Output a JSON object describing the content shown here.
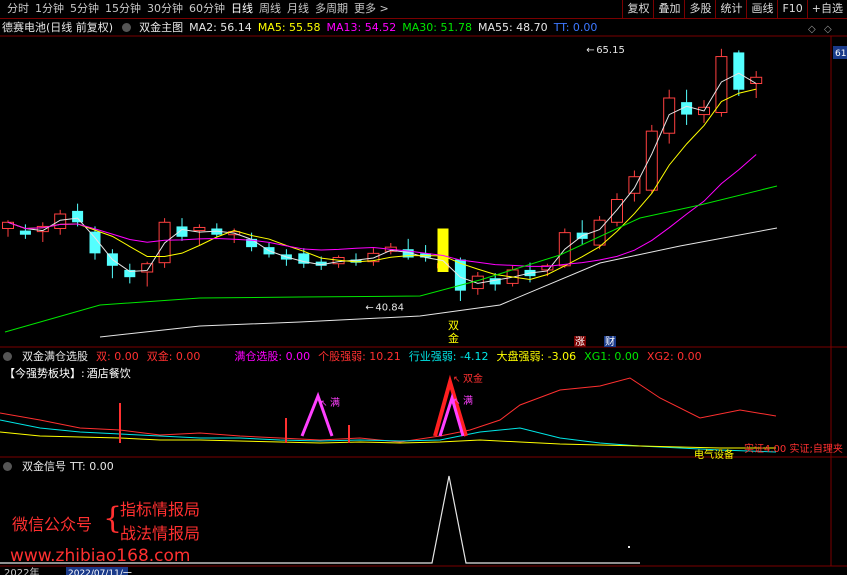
{
  "toolbar": {
    "periods": [
      {
        "label": "分时",
        "active": false
      },
      {
        "label": "1分钟",
        "active": false
      },
      {
        "label": "5分钟",
        "active": false
      },
      {
        "label": "15分钟",
        "active": false
      },
      {
        "label": "30分钟",
        "active": false
      },
      {
        "label": "60分钟",
        "active": false
      },
      {
        "label": "日线",
        "active": true
      },
      {
        "label": "周线",
        "active": false
      },
      {
        "label": "月线",
        "active": false
      },
      {
        "label": "多周期",
        "active": false
      },
      {
        "label": "更多 >",
        "active": false
      }
    ],
    "right_buttons": [
      "复权",
      "叠加",
      "多股",
      "统计",
      "画线",
      "F10",
      "+自选"
    ]
  },
  "main": {
    "stock_name": "德赛电池(日线 前复权)",
    "indicator_name": "双金主图",
    "ma": [
      {
        "label": "MA2: 56.14",
        "color": "#e6e6e6"
      },
      {
        "label": "MA5: 55.58",
        "color": "#ffff00"
      },
      {
        "label": "MA13: 54.52",
        "color": "#ff00ff"
      },
      {
        "label": "MA30: 51.78",
        "color": "#00e600"
      },
      {
        "label": "MA55: 48.70",
        "color": "#e6e6e6"
      },
      {
        "label": "TT: 0.00",
        "color": "#3c78ff"
      }
    ],
    "high_label": "65.15",
    "low_label": "40.84",
    "signal_label_1": "双",
    "signal_label_2": "金",
    "mark_zhang": "涨",
    "mark_cai": "财",
    "right_value": "61"
  },
  "sub1": {
    "title": "双金满仓选股",
    "values": [
      {
        "label": "双: 0.00",
        "color": "#ff3030"
      },
      {
        "label": "双金: 0.00",
        "color": "#ff3030"
      },
      {
        "label": "满仓选股: 0.00",
        "color": "#ff00ff"
      },
      {
        "label": "个股强弱: 10.21",
        "color": "#ff3030"
      },
      {
        "label": "行业强弱: -4.12",
        "color": "#00e6e6"
      },
      {
        "label": "大盘强弱: -3.06",
        "color": "#ffff00"
      },
      {
        "label": "XG1: 0.00",
        "color": "#00e600"
      },
      {
        "label": "XG2: 0.00",
        "color": "#ff3030"
      }
    ],
    "sector_prefix": "【今强势板块】:",
    "sector_name": "酒店餐饮",
    "label_man1": "满",
    "label_shuangjin": "双金",
    "label_man2": "满",
    "bottom_yellow": "电气设备",
    "bottom_red": "实证4.00 实证;自理夹"
  },
  "sub2": {
    "title": "双金信号",
    "value": "TT: 0.00"
  },
  "ad": {
    "line1": "微信公众号",
    "brace": "{",
    "line2": "指标情报局",
    "line3": "战法情报局",
    "site": "www.zhibiao168.com"
  },
  "date_axis": {
    "date1": "2022年",
    "date2": "2022/07/11/一"
  },
  "chart_data": {
    "type": "candlestick",
    "x_count": 44,
    "candles": [
      {
        "o": 47.8,
        "h": 48.6,
        "l": 47.0,
        "c": 48.4
      },
      {
        "o": 47.6,
        "h": 48.2,
        "l": 46.8,
        "c": 47.2
      },
      {
        "o": 47.5,
        "h": 48.4,
        "l": 46.5,
        "c": 48.0
      },
      {
        "o": 47.8,
        "h": 49.6,
        "l": 47.2,
        "c": 49.2
      },
      {
        "o": 49.5,
        "h": 50.2,
        "l": 48.0,
        "c": 48.4
      },
      {
        "o": 47.5,
        "h": 48.0,
        "l": 44.8,
        "c": 45.4
      },
      {
        "o": 45.4,
        "h": 45.8,
        "l": 43.0,
        "c": 44.2
      },
      {
        "o": 43.8,
        "h": 44.4,
        "l": 42.5,
        "c": 43.1
      },
      {
        "o": 43.6,
        "h": 44.6,
        "l": 42.2,
        "c": 44.4
      },
      {
        "o": 44.5,
        "h": 48.8,
        "l": 44.0,
        "c": 48.4
      },
      {
        "o": 48.0,
        "h": 48.8,
        "l": 46.6,
        "c": 47.0
      },
      {
        "o": 47.6,
        "h": 48.2,
        "l": 46.2,
        "c": 47.9
      },
      {
        "o": 47.8,
        "h": 48.3,
        "l": 47.0,
        "c": 47.2
      },
      {
        "o": 47.2,
        "h": 47.8,
        "l": 46.4,
        "c": 47.5
      },
      {
        "o": 46.8,
        "h": 47.4,
        "l": 45.6,
        "c": 46.0
      },
      {
        "o": 46.0,
        "h": 46.4,
        "l": 45.0,
        "c": 45.3
      },
      {
        "o": 45.3,
        "h": 45.8,
        "l": 44.2,
        "c": 44.8
      },
      {
        "o": 45.4,
        "h": 45.9,
        "l": 44.0,
        "c": 44.4
      },
      {
        "o": 44.6,
        "h": 45.1,
        "l": 43.8,
        "c": 44.2
      },
      {
        "o": 44.4,
        "h": 45.2,
        "l": 44.0,
        "c": 45.0
      },
      {
        "o": 44.8,
        "h": 45.4,
        "l": 44.2,
        "c": 44.5
      },
      {
        "o": 44.6,
        "h": 45.9,
        "l": 44.2,
        "c": 45.4
      },
      {
        "o": 45.6,
        "h": 46.4,
        "l": 45.3,
        "c": 46.0
      },
      {
        "o": 45.8,
        "h": 46.8,
        "l": 44.8,
        "c": 45.0
      },
      {
        "o": 45.4,
        "h": 46.2,
        "l": 44.6,
        "c": 45.0
      },
      {
        "o": 44.0,
        "h": 44.6,
        "l": 43.6,
        "c": 44.4
      },
      {
        "o": 44.8,
        "h": 45.0,
        "l": 40.8,
        "c": 41.8
      },
      {
        "o": 42.0,
        "h": 43.6,
        "l": 41.4,
        "c": 43.2
      },
      {
        "o": 43.0,
        "h": 43.5,
        "l": 41.8,
        "c": 42.4
      },
      {
        "o": 42.5,
        "h": 44.2,
        "l": 42.2,
        "c": 43.8
      },
      {
        "o": 43.8,
        "h": 44.5,
        "l": 42.6,
        "c": 43.2
      },
      {
        "o": 43.8,
        "h": 44.4,
        "l": 43.2,
        "c": 44.2
      },
      {
        "o": 44.2,
        "h": 47.8,
        "l": 44.0,
        "c": 47.4
      },
      {
        "o": 47.4,
        "h": 48.6,
        "l": 46.2,
        "c": 46.8
      },
      {
        "o": 46.2,
        "h": 49.0,
        "l": 45.8,
        "c": 48.6
      },
      {
        "o": 48.4,
        "h": 51.2,
        "l": 48.0,
        "c": 50.6
      },
      {
        "o": 51.2,
        "h": 53.4,
        "l": 50.4,
        "c": 52.8
      },
      {
        "o": 51.5,
        "h": 57.8,
        "l": 51.2,
        "c": 57.2
      },
      {
        "o": 57.0,
        "h": 61.2,
        "l": 56.0,
        "c": 60.4
      },
      {
        "o": 60.0,
        "h": 61.2,
        "l": 57.8,
        "c": 58.8
      },
      {
        "o": 58.8,
        "h": 60.2,
        "l": 58.0,
        "c": 59.5
      },
      {
        "o": 59.0,
        "h": 65.15,
        "l": 58.6,
        "c": 64.4
      },
      {
        "o": 64.8,
        "h": 65.0,
        "l": 60.6,
        "c": 61.2
      },
      {
        "o": 61.8,
        "h": 63.0,
        "l": 60.4,
        "c": 62.4
      }
    ],
    "ylim": [
      38,
      66
    ]
  }
}
